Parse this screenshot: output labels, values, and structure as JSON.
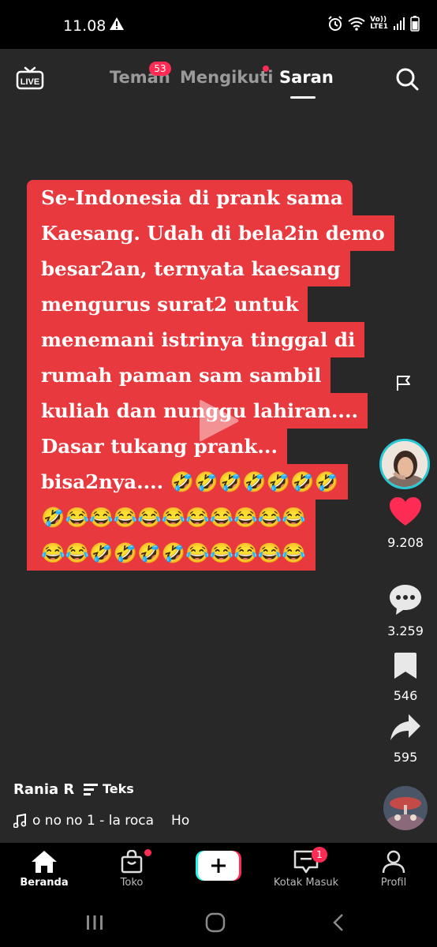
{
  "status_bar": {
    "time": "11.08",
    "icons": [
      "warning-icon",
      "alarm-icon",
      "wifi-icon",
      "volte-icon",
      "signal-icon",
      "battery-icon"
    ],
    "network_label_top": "Vo))",
    "network_label_bottom": "LTE1"
  },
  "top_nav": {
    "live_label": "LIVE",
    "tabs": [
      {
        "label": "Teman",
        "badge": "53"
      },
      {
        "label": "Mengikuti",
        "dot": true
      },
      {
        "label": "Saran",
        "active": true
      }
    ]
  },
  "caption": {
    "lines": [
      "Se-Indonesia di prank sama",
      "Kaesang. Udah di bela2in demo",
      "besar2an, ternyata kaesang",
      "mengurus surat2 untuk",
      "menemani istrinya tinggal di",
      "rumah paman sam sambil",
      "kuliah dan nunggu lahiran....",
      "Dasar tukang prank...",
      "bisa2nya.... 🤣🤣🤣🤣🤣🤣🤣",
      "🤣😂😂😂😂😂😂😂😂😂😂",
      "😂😂🤣🤣🤣🤣😂😂😂😂😂"
    ]
  },
  "actions": {
    "likes": "9.208",
    "comments": "3.259",
    "saves": "546",
    "shares": "595"
  },
  "post": {
    "author": "Rania R",
    "teks_label": "Teks",
    "music": "o no no 1 - la roca",
    "music_more": "Ho"
  },
  "bottom_nav": {
    "beranda": "Beranda",
    "toko": "Toko",
    "kotak_masuk": "Kotak Masuk",
    "kotak_badge": "1",
    "profil": "Profil"
  },
  "colors": {
    "accent": "#fe2c55",
    "caption_bg": "#e8393e",
    "background": "#282828",
    "avatar_ring": "#29c8d6"
  }
}
